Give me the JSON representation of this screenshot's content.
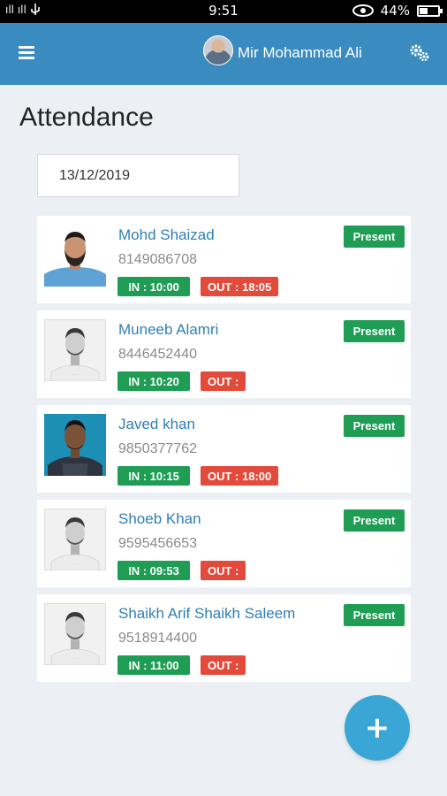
{
  "status_bar": {
    "signal_text": "ıll ıll",
    "time": "9:51",
    "battery_percent": "44%",
    "battery_level": 0.44
  },
  "app_bar": {
    "user_name": "Mir Mohammad Ali"
  },
  "page": {
    "title": "Attendance",
    "date_value": "13/12/2019"
  },
  "employees": [
    {
      "name": "Mohd Shaizad",
      "phone": "8149086708",
      "status": "Present",
      "in": "IN : 10:00",
      "out": "OUT : 18:05",
      "photo": "bearded-man-blue-bg"
    },
    {
      "name": "Muneeb Alamri",
      "phone": "8446452440",
      "status": "Present",
      "in": "IN : 10:20",
      "out": "OUT :",
      "photo": "placeholder-man-grayscale"
    },
    {
      "name": "Javed khan",
      "phone": "9850377762",
      "status": "Present",
      "in": "IN : 10:15",
      "out": "OUT : 18:00",
      "photo": "man-teal-bg"
    },
    {
      "name": "Shoeb Khan",
      "phone": "9595456653",
      "status": "Present",
      "in": "IN : 09:53",
      "out": "OUT :",
      "photo": "placeholder-man-grayscale"
    },
    {
      "name": "Shaikh Arif Shaikh Saleem",
      "phone": "9518914400",
      "status": "Present",
      "in": "IN : 11:00",
      "out": "OUT :",
      "photo": "placeholder-man-grayscale"
    }
  ],
  "fab": {
    "label": "+"
  },
  "colors": {
    "app_bar": "#3a8bc0",
    "name_link": "#2f7fb6",
    "present_green": "#1f9d55",
    "out_red": "#e24b3b",
    "fab_blue": "#3aa6d6",
    "background": "#ecf0f4"
  }
}
